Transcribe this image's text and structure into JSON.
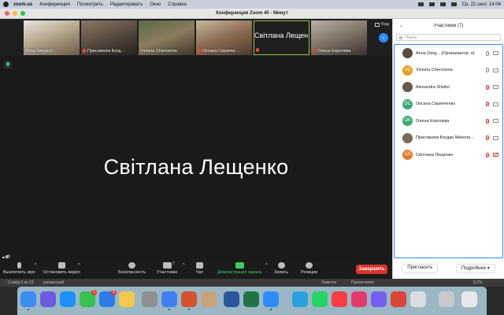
{
  "menubar": {
    "app": "zoom.us",
    "items": [
      "Конференция",
      "Посмотреть",
      "Редактировать",
      "Окно",
      "Справка"
    ],
    "clock": "Ср, 22 сент. 14:04"
  },
  "window": {
    "title": "Конференция Zoom   40 - Минут"
  },
  "thumbnails": [
    {
      "name": "Anna Dergach",
      "muted": false
    },
    {
      "name": "Присяжнюк Богд...",
      "muted": true
    },
    {
      "name": "Victoria Chervonna",
      "muted": false
    },
    {
      "name": "Оксана Скрипче...",
      "muted": true
    },
    {
      "name": "Світлана Лещ...",
      "muted": true,
      "namecard": "Світлана Лещен..."
    },
    {
      "name": "Олена Коротківа",
      "muted": true
    }
  ],
  "view_button": "Вид",
  "speaker_name": "Світлана Лещенко",
  "toolbar": {
    "mute": "Выключить звук",
    "video": "Остановить видео",
    "security": "Безопасность",
    "participants": "Участники",
    "participants_count": "7",
    "chat": "Чат",
    "share": "Демонстрация экрана",
    "record": "Запись",
    "reactions": "Реакции",
    "end": "Завершить"
  },
  "panel": {
    "title": "Участники (7)",
    "search_placeholder": "Поиск",
    "participants": [
      {
        "name": "Anna Derg... (Организатор, я)",
        "initials": "",
        "color": "#5a4a3c",
        "mic_muted": false,
        "video_off": false
      },
      {
        "name": "Victoria Chervonna",
        "initials": "VC",
        "color": "#e5a11f",
        "mic_muted": false,
        "video_off": false
      },
      {
        "name": "Alexandra Sheiko",
        "initials": "",
        "color": "#6a5848",
        "mic_muted": true,
        "video_off": false
      },
      {
        "name": "Оксана Скрипченко",
        "initials": "ОС",
        "color": "#3aa876",
        "mic_muted": true,
        "video_off": false
      },
      {
        "name": "Олена Коротківа",
        "initials": "ОК",
        "color": "#3aa876",
        "mic_muted": true,
        "video_off": false
      },
      {
        "name": "Присяжнюк Богдан Микола...",
        "initials": "",
        "color": "#7a6a55",
        "mic_muted": true,
        "video_off": false
      },
      {
        "name": "Світлана Лещенко",
        "initials": "СЛ",
        "color": "#e37a2c",
        "mic_muted": true,
        "video_off": true
      }
    ],
    "invite": "Пригласить",
    "more": "Подробнее ▾"
  },
  "statusbar": {
    "slide": "Слайд 9 из 19",
    "language": "украинский",
    "notes": "Заметки",
    "comments": "Примечания",
    "zoom": "112%"
  }
}
